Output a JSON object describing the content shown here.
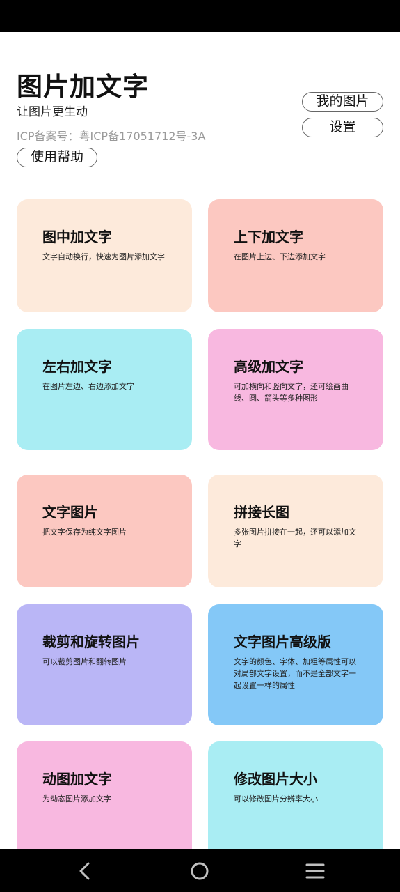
{
  "header": {
    "title": "图片加文字",
    "subtitle": "让图片更生动",
    "icp": "ICP备案号：粤ICP备17051712号-3A",
    "help_button": "使用帮助",
    "my_images_button": "我的图片",
    "settings_button": "设置"
  },
  "cards": [
    {
      "title": "图中加文字",
      "desc": "文字自动换行，快速为图片添加文字",
      "color": "#FDEADB"
    },
    {
      "title": "上下加文字",
      "desc": "在图片上边、下边添加文字",
      "color": "#FCC8C1"
    },
    {
      "title": "左右加文字",
      "desc": "在图片左边、右边添加文字",
      "color": "#A9EDF3"
    },
    {
      "title": "高级加文字",
      "desc": "可加横向和竖向文字，还可绘画曲线、圆、箭头等多种图形",
      "color": "#F8B8E0"
    },
    {
      "title": "文字图片",
      "desc": "把文字保存为纯文字图片",
      "color": "#FCC8C1"
    },
    {
      "title": "拼接长图",
      "desc": "多张图片拼接在一起，还可以添加文字",
      "color": "#FDEADB"
    },
    {
      "title": "裁剪和旋转图片",
      "desc": "可以裁剪图片和翻转图片",
      "color": "#BAB6F6"
    },
    {
      "title": "文字图片高级版",
      "desc": "文字的颜色、字体、加粗等属性可以对局部文字设置，而不是全部文字一起设置一样的属性",
      "color": "#84C8F7"
    },
    {
      "title": "动图加文字",
      "desc": "为动态图片添加文字",
      "color": "#F8B8E0"
    },
    {
      "title": "修改图片大小",
      "desc": "可以修改图片分辨率大小",
      "color": "#A9EDF3"
    }
  ],
  "nav": {
    "back_icon": "back-icon",
    "home_icon": "home-icon",
    "menu_icon": "menu-icon"
  }
}
